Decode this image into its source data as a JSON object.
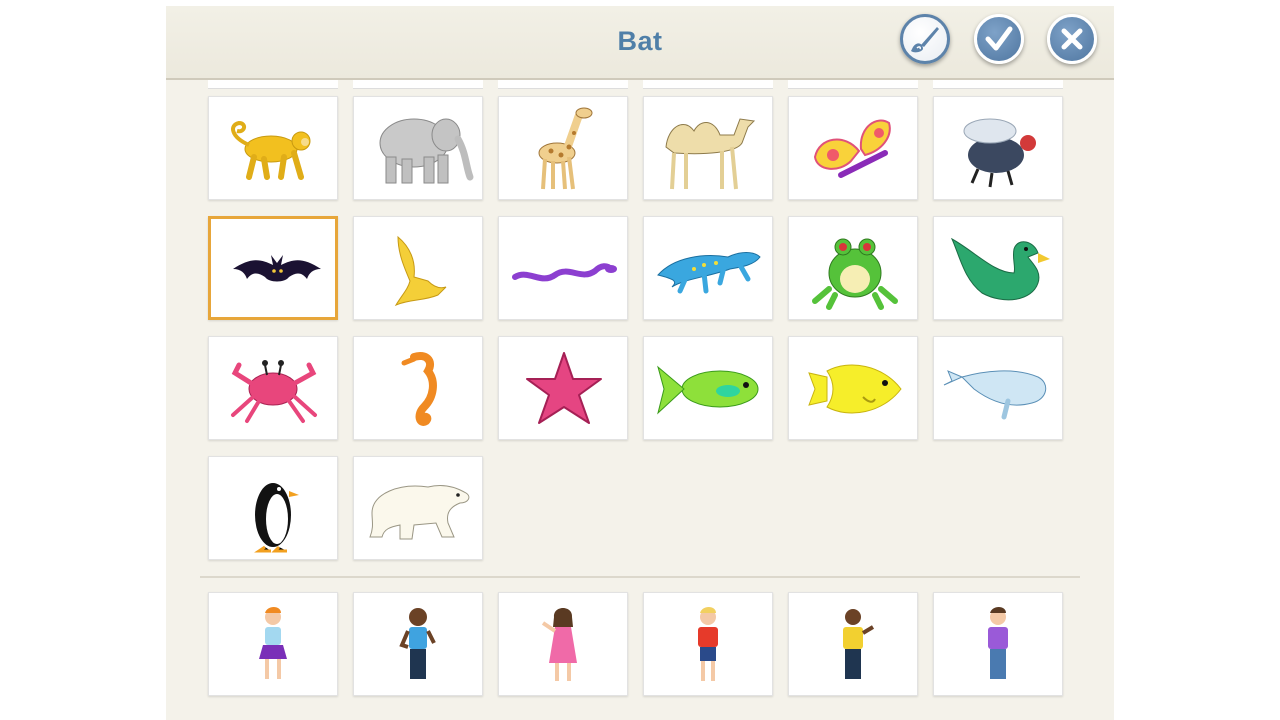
{
  "header": {
    "title": "Bat",
    "buttons": [
      {
        "name": "paint-editor-button",
        "icon": "paintbrush-icon"
      },
      {
        "name": "confirm-button",
        "icon": "checkmark-icon"
      },
      {
        "name": "close-button",
        "icon": "close-icon"
      }
    ]
  },
  "animals": [
    {
      "name": "monkey",
      "icon": "monkey-icon"
    },
    {
      "name": "elephant",
      "icon": "elephant-icon"
    },
    {
      "name": "giraffe",
      "icon": "giraffe-icon"
    },
    {
      "name": "camel",
      "icon": "camel-icon"
    },
    {
      "name": "butterfly",
      "icon": "butterfly-icon"
    },
    {
      "name": "fly",
      "icon": "fly-icon"
    },
    {
      "name": "bat",
      "icon": "bat-icon",
      "selected": true
    },
    {
      "name": "bird",
      "icon": "bird-icon"
    },
    {
      "name": "snake",
      "icon": "snake-icon"
    },
    {
      "name": "lizard",
      "icon": "lizard-icon"
    },
    {
      "name": "frog",
      "icon": "frog-icon"
    },
    {
      "name": "duck",
      "icon": "duck-icon"
    },
    {
      "name": "crab",
      "icon": "crab-icon"
    },
    {
      "name": "seahorse",
      "icon": "seahorse-icon"
    },
    {
      "name": "starfish",
      "icon": "starfish-icon"
    },
    {
      "name": "green-fish",
      "icon": "green-fish-icon"
    },
    {
      "name": "yellow-fish",
      "icon": "yellow-fish-icon"
    },
    {
      "name": "whale",
      "icon": "whale-icon"
    },
    {
      "name": "penguin",
      "icon": "penguin-icon"
    },
    {
      "name": "polar-bear",
      "icon": "polar-bear-icon"
    }
  ],
  "characters": [
    {
      "name": "girl-red-hair",
      "icon": "character-icon"
    },
    {
      "name": "girl-blue-shirt",
      "icon": "character-icon"
    },
    {
      "name": "girl-pink-dress",
      "icon": "character-icon"
    },
    {
      "name": "boy-red-shirt",
      "icon": "character-icon"
    },
    {
      "name": "boy-yellow-shirt",
      "icon": "character-icon"
    },
    {
      "name": "boy-purple-shirt",
      "icon": "character-icon"
    }
  ],
  "colors": {
    "title": "#4f7fa8",
    "selection": "#e7a63a",
    "button": "#5d83aa"
  }
}
